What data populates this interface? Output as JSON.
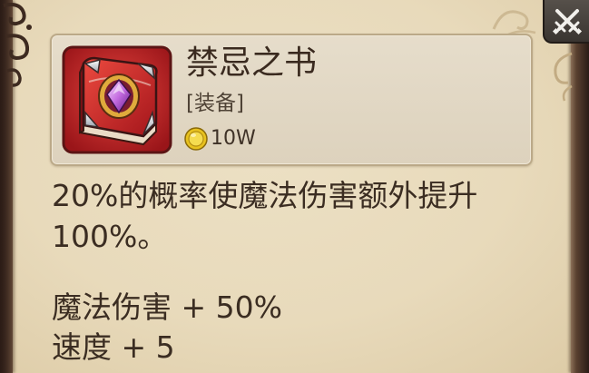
{
  "window": {
    "close_icon": "crossed-swords-icon"
  },
  "item": {
    "name": "禁忌之书",
    "type": "[装备]",
    "price": "10W",
    "price_icon": "gold-coin-icon",
    "icon": "red-book-icon"
  },
  "description": {
    "lines": [
      "20%的概率使魔法伤害额外提升",
      "100%。"
    ]
  },
  "stats": [
    "魔法伤害 + 50%",
    "速度 + 5"
  ],
  "colors": {
    "parchment": "#e8dbbd",
    "frame": "#3a271e",
    "card": "#e2d8c4",
    "text": "#3b2d22",
    "icon_bg": "#b81f24",
    "gem": "#c46be0",
    "coin": "#e8c21f"
  }
}
